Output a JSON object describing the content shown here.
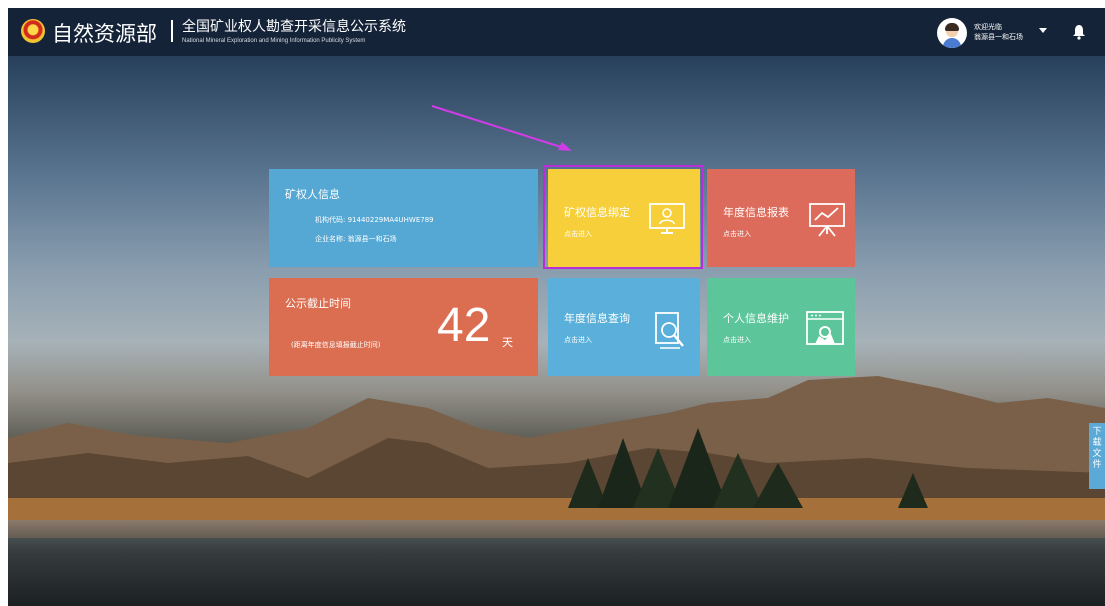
{
  "header": {
    "ministry": "自然资源部",
    "system_title": "全国矿业权人勘查开采信息公示系统",
    "system_title_en": "National Mineral Exploration and Mining Information Publicity System"
  },
  "user": {
    "welcome": "欢迎光临",
    "name": "翁源县一和石场"
  },
  "tiles": {
    "holder_info": {
      "title": "矿权人信息",
      "org_code_label": "机构代码:",
      "org_code": "91440229MA4UHWE789",
      "company_label": "企业名称:",
      "company": "翁源县一和石场"
    },
    "deadline": {
      "title": "公示截止时间",
      "note": "(距离年度信息填报截止时间)",
      "days": "42",
      "unit": "天"
    },
    "binding": {
      "title": "矿权信息绑定",
      "action": "点击进入"
    },
    "annual_report": {
      "title": "年度信息报表",
      "action": "点击进入"
    },
    "annual_query": {
      "title": "年度信息查询",
      "action": "点击进入"
    },
    "profile": {
      "title": "个人信息维护",
      "action": "点击进入"
    }
  },
  "side_tab": {
    "label": "下载文件"
  },
  "colors": {
    "topbar": "#142338",
    "tile_blue": "#55a8d3",
    "tile_orange": "#db6e51",
    "tile_yellow": "#f6cf3a",
    "tile_red": "#dd6b5c",
    "tile_light_blue": "#5ab0da",
    "tile_green": "#5cc69a",
    "highlight": "#b72fd6"
  }
}
